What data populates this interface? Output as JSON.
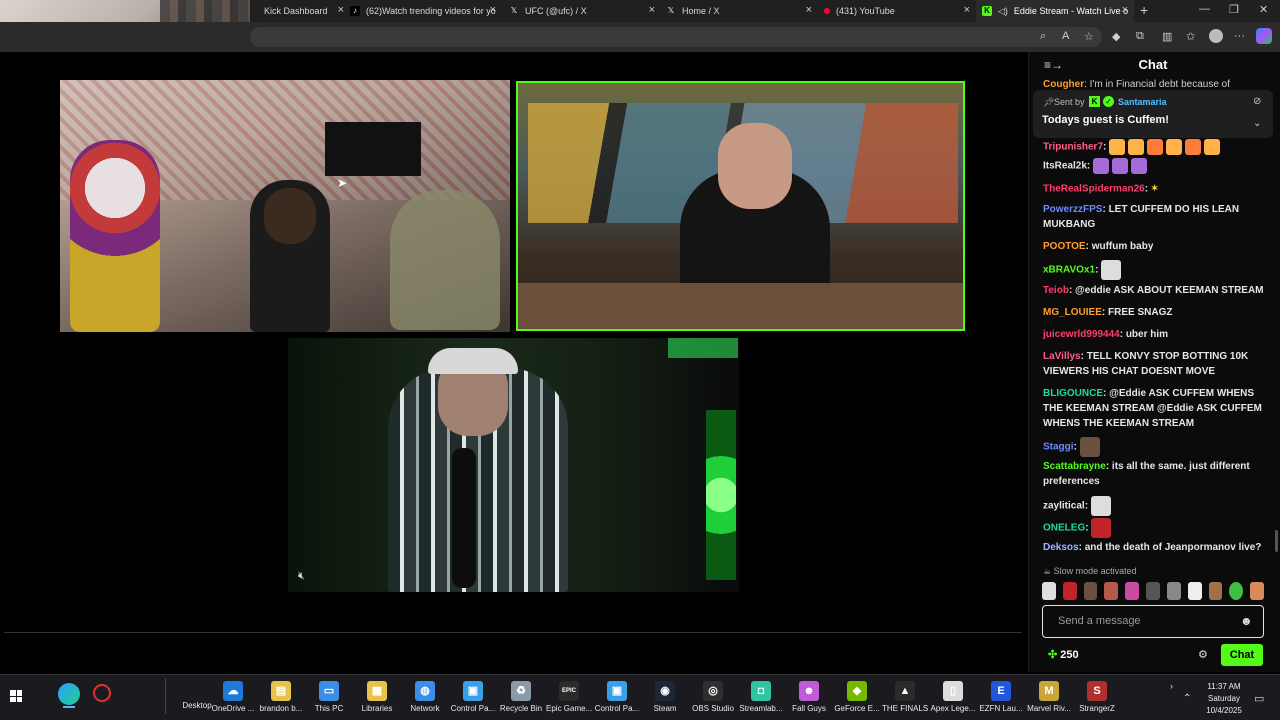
{
  "browser": {
    "tabs": [
      {
        "label": "Kick Dashboard",
        "icon": "kick-icon"
      },
      {
        "label": "(62)Watch trending videos for yo",
        "icon": "tiktok-icon"
      },
      {
        "label": "UFC (@ufc) / X",
        "icon": "x-icon"
      },
      {
        "label": "Home / X",
        "icon": "x-icon"
      },
      {
        "label": "(431) YouTube",
        "icon": "youtube-icon"
      },
      {
        "label": "Eddie Stream - Watch Live o",
        "icon": "kick-icon"
      }
    ],
    "new_tab": "+",
    "close": "×",
    "minimize": "—",
    "maximize": "❐",
    "window_close": "✕"
  },
  "chat": {
    "title": "Chat",
    "pinned": {
      "sent_by_label": "Sent by",
      "sender": "Santamaria",
      "text": "Todays guest is Cuffem!"
    },
    "partial_top": {
      "user": "Cougher",
      "text": "I'm in Financial debt because of"
    },
    "messages": [
      {
        "user": "Tripunisher7",
        "color": "#ff5e8a",
        "text": "",
        "emotes": 6
      },
      {
        "user": "ItsReal2k",
        "color": "#e6e6e6",
        "text": "",
        "emotes": 3
      },
      {
        "user": "TheRealSpiderman26",
        "color": "#ff3d6e",
        "text": "",
        "emotes": 1
      },
      {
        "user": "PowerzzFPS",
        "color": "#6b8cff",
        "text": "LET CUFFEM DO HIS LEAN MUKBANG"
      },
      {
        "user": "POOTOE",
        "color": "#ff9f2e",
        "text": "wuffum baby"
      },
      {
        "user": "xBRAVOx1",
        "color": "#53fc18",
        "text": "",
        "emotes": 1
      },
      {
        "user": "Teiob",
        "color": "#ff3d6e",
        "text": "@eddie ASK ABOUT KEEMAN STREAM"
      },
      {
        "user": "MG_LOUIEE",
        "color": "#ff9f2e",
        "text": "FREE SNAGZ"
      },
      {
        "user": "juicewrld999444",
        "color": "#ff3d6e",
        "text": "uber him"
      },
      {
        "user": "LaVillys",
        "color": "#ff5e8a",
        "text": "TELL KONVY STOP BOTTING 10K VIEWERS HIS CHAT DOESNT MOVE"
      },
      {
        "user": "BLIGOUNCE",
        "color": "#1ed9a0",
        "text": "@Eddie ASK CUFFEM WHENS THE KEEMAN STREAM @Eddie ASK CUFFEM WHENS THE KEEMAN STREAM"
      },
      {
        "user": "Staggi",
        "color": "#6b8cff",
        "text": "",
        "emotes": 1
      },
      {
        "user": "Scattabrayne",
        "color": "#53fc18",
        "text": "its all the same. just different preferences"
      },
      {
        "user": "zaylitical",
        "color": "#e6e6e6",
        "text": "",
        "emotes": 1
      },
      {
        "user": "ONELEG",
        "color": "#1ed9a0",
        "text": "",
        "emotes": 1
      },
      {
        "user": "Deksos",
        "color": "#9ab8ff",
        "text": "and the death of Jeanpormanov live?"
      }
    ],
    "slow_mode": "Slow mode activated",
    "input_placeholder": "Send a message",
    "points": "250",
    "send_label": "Chat"
  },
  "taskbar": {
    "apps": [
      {
        "label": "Desktop",
        "color": "#2a2a2a",
        "glyph": ""
      },
      {
        "label": "OneDrive ...",
        "color": "#1e7ad6",
        "glyph": "☁"
      },
      {
        "label": "brandon b...",
        "color": "#e8c34a",
        "glyph": "▤"
      },
      {
        "label": "This PC",
        "color": "#3a8ee6",
        "glyph": "▭"
      },
      {
        "label": "Libraries",
        "color": "#e8c34a",
        "glyph": "▦"
      },
      {
        "label": "Network",
        "color": "#3a8ee6",
        "glyph": "◍"
      },
      {
        "label": "Control Pa...",
        "color": "#3aa0e6",
        "glyph": "▣"
      },
      {
        "label": "Recycle Bin",
        "color": "#8a9aa8",
        "glyph": "♻"
      },
      {
        "label": "Epic Game...",
        "color": "#2b2b2b",
        "glyph": "EPIC"
      },
      {
        "label": "Control Pa...",
        "color": "#3aa0e6",
        "glyph": "▣"
      },
      {
        "label": "Steam",
        "color": "#1b2838",
        "glyph": "◉"
      },
      {
        "label": "OBS Studio",
        "color": "#302e31",
        "glyph": "◎"
      },
      {
        "label": "Streamlab...",
        "color": "#31c3a2",
        "glyph": "◘"
      },
      {
        "label": "Fall Guys",
        "color": "#c05bd6",
        "glyph": "☻"
      },
      {
        "label": "GeForce E...",
        "color": "#76b900",
        "glyph": "◆"
      },
      {
        "label": "THE FINALS",
        "color": "#2b2b2b",
        "glyph": "▲"
      },
      {
        "label": "Apex Lege...",
        "color": "#dcdcdc",
        "glyph": "▯"
      },
      {
        "label": "EZFN Lau...",
        "color": "#2255dd",
        "glyph": "E"
      },
      {
        "label": "Marvel Riv...",
        "color": "#c8a63a",
        "glyph": "M"
      },
      {
        "label": "StrangerZ",
        "color": "#b03030",
        "glyph": "S"
      }
    ],
    "time": "11:37 AM",
    "day": "Saturday",
    "date": "10/4/2025"
  }
}
